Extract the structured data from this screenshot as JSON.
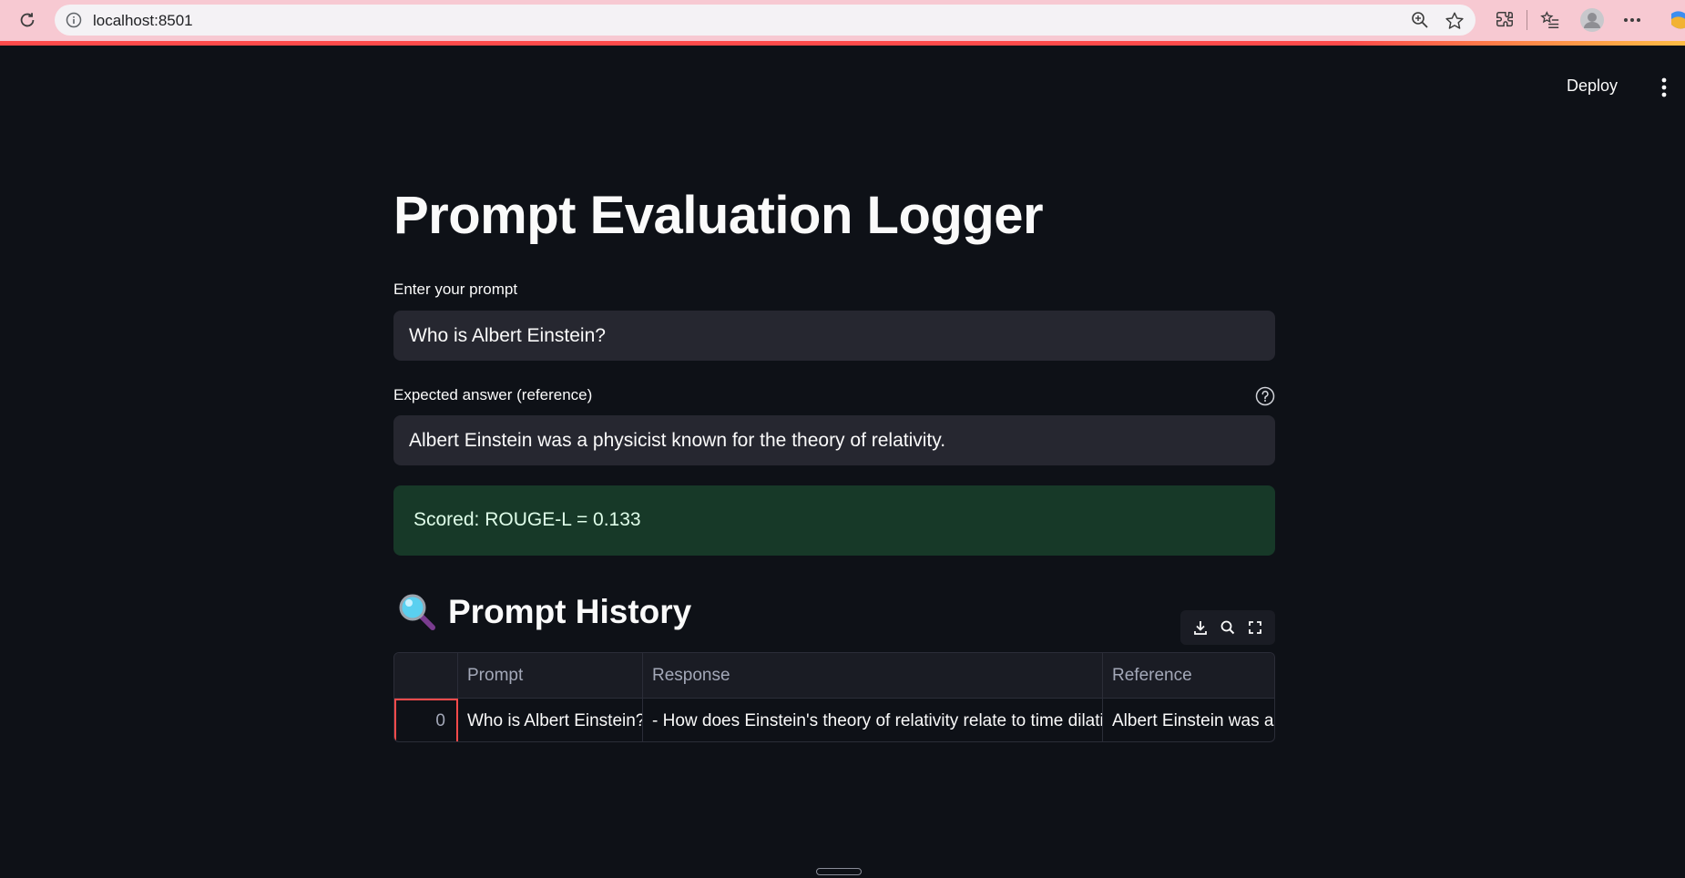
{
  "browser": {
    "url": "localhost:8501"
  },
  "header": {
    "deploy_label": "Deploy"
  },
  "main": {
    "title": "Prompt Evaluation Logger",
    "prompt_label": "Enter your prompt",
    "prompt_value": "Who is Albert Einstein?",
    "reference_label": "Expected answer (reference)",
    "reference_value": "Albert Einstein was a physicist known for the theory of relativity.",
    "score_message": "Scored: ROUGE-L = 0.133",
    "history_heading": "Prompt History",
    "history_icon": "magnifying-glass-emoji"
  },
  "table": {
    "columns": [
      "",
      "Prompt",
      "Response",
      "Reference"
    ],
    "rows": [
      {
        "index": "0",
        "prompt": "Who is Albert Einstein?",
        "response": "- How does Einstein's theory of relativity relate to time dilation",
        "reference": "Albert Einstein was a p"
      }
    ]
  },
  "colors": {
    "background": "#0e1117",
    "input_bg": "#262730",
    "success_bg": "#173928",
    "accent": "#ff4b4b"
  }
}
